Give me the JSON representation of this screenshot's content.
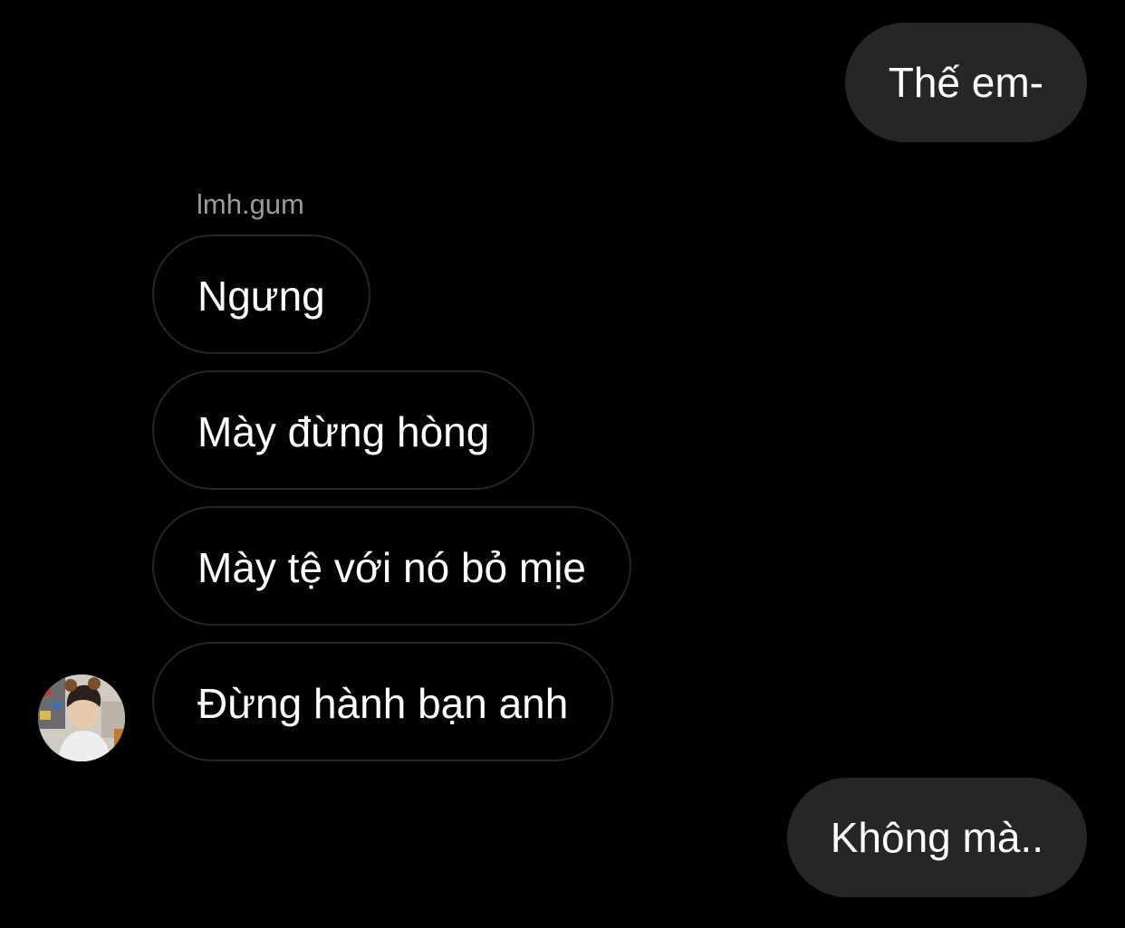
{
  "conversation": {
    "messages": [
      {
        "direction": "outgoing",
        "text": "Thế em-"
      },
      {
        "direction": "incoming",
        "text": "Ngưng"
      },
      {
        "direction": "incoming",
        "text": "Mày đừng hòng"
      },
      {
        "direction": "incoming",
        "text": "Mày tệ với nó bỏ mịe"
      },
      {
        "direction": "incoming",
        "text": "Đừng hành bạn anh"
      },
      {
        "direction": "outgoing",
        "text": "Không mà.."
      }
    ],
    "incoming_sender": "lmh.gum"
  },
  "colors": {
    "background": "#000000",
    "outgoing_bubble": "#262626",
    "incoming_border": "#262626",
    "text": "#ffffff",
    "sender_name": "#9a9a9a"
  },
  "icons": {
    "avatar": "profile-photo"
  }
}
